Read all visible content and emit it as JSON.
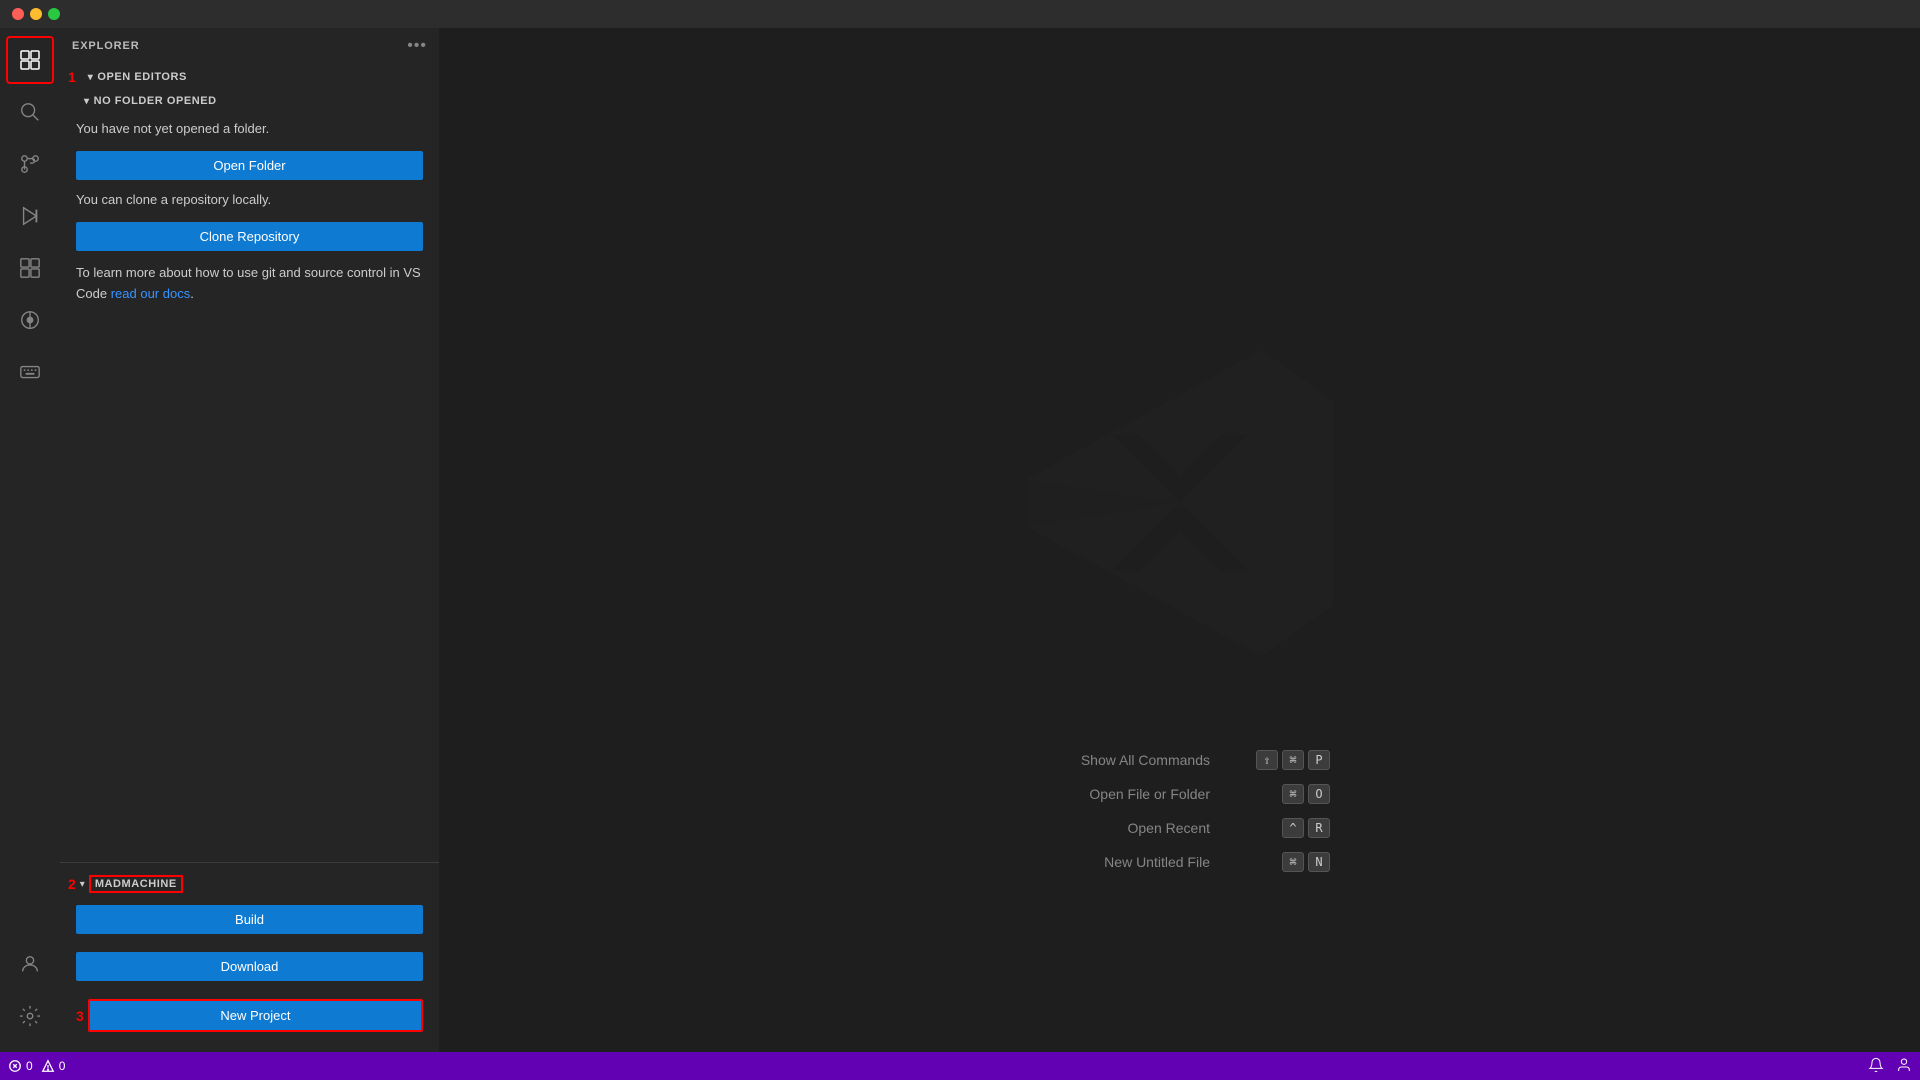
{
  "titlebar": {
    "traffic": [
      "close",
      "minimize",
      "maximize"
    ]
  },
  "activity": {
    "icons": [
      {
        "name": "explorer-icon",
        "symbol": "⧉",
        "active": true
      },
      {
        "name": "search-icon",
        "symbol": "🔍",
        "active": false
      },
      {
        "name": "source-control-icon",
        "symbol": "⑂",
        "active": false
      },
      {
        "name": "run-debug-icon",
        "symbol": "▶",
        "active": false
      },
      {
        "name": "extensions-icon",
        "symbol": "⊞",
        "active": false
      },
      {
        "name": "timeline-icon",
        "symbol": "⊙",
        "active": false
      },
      {
        "name": "keyboard-icon",
        "symbol": "⌨",
        "active": false
      },
      {
        "name": "account-icon",
        "symbol": "👤",
        "active": false
      },
      {
        "name": "settings-icon",
        "symbol": "⚙",
        "active": false
      }
    ]
  },
  "sidebar": {
    "title": "EXPLORER",
    "more_label": "•••",
    "section1_number": "1",
    "open_editors_label": "OPEN EDITORS",
    "no_folder_label": "NO FOLDER OPENED",
    "no_folder_text": "You have not yet opened a folder.",
    "open_folder_label": "Open Folder",
    "clone_text": "You can clone a repository locally.",
    "clone_label": "Clone Repository",
    "hint_text_before": "To learn more about how to use git and source control in VS Code ",
    "hint_link": "read our docs",
    "hint_text_after": ".",
    "section2_number": "2",
    "madmachine_label": "MADMACHINE",
    "build_label": "Build",
    "download_label": "Download",
    "section3_number": "3",
    "new_project_label": "New Project"
  },
  "shortcuts": [
    {
      "label": "Show All Commands",
      "keys": [
        "⇧",
        "⌘",
        "P"
      ]
    },
    {
      "label": "Open File or Folder",
      "keys": [
        "⌘",
        "O"
      ]
    },
    {
      "label": "Open Recent",
      "keys": [
        "^",
        "R"
      ]
    },
    {
      "label": "New Untitled File",
      "keys": [
        "⌘",
        "N"
      ]
    }
  ],
  "statusbar": {
    "errors": "0",
    "warnings": "0",
    "error_icon": "✕",
    "warning_icon": "⚠"
  },
  "colors": {
    "accent_blue": "#0e7ad2",
    "accent_red": "#ff0000",
    "status_purple": "#6200b3",
    "sidebar_bg": "#252526",
    "main_bg": "#1e1e1e"
  }
}
